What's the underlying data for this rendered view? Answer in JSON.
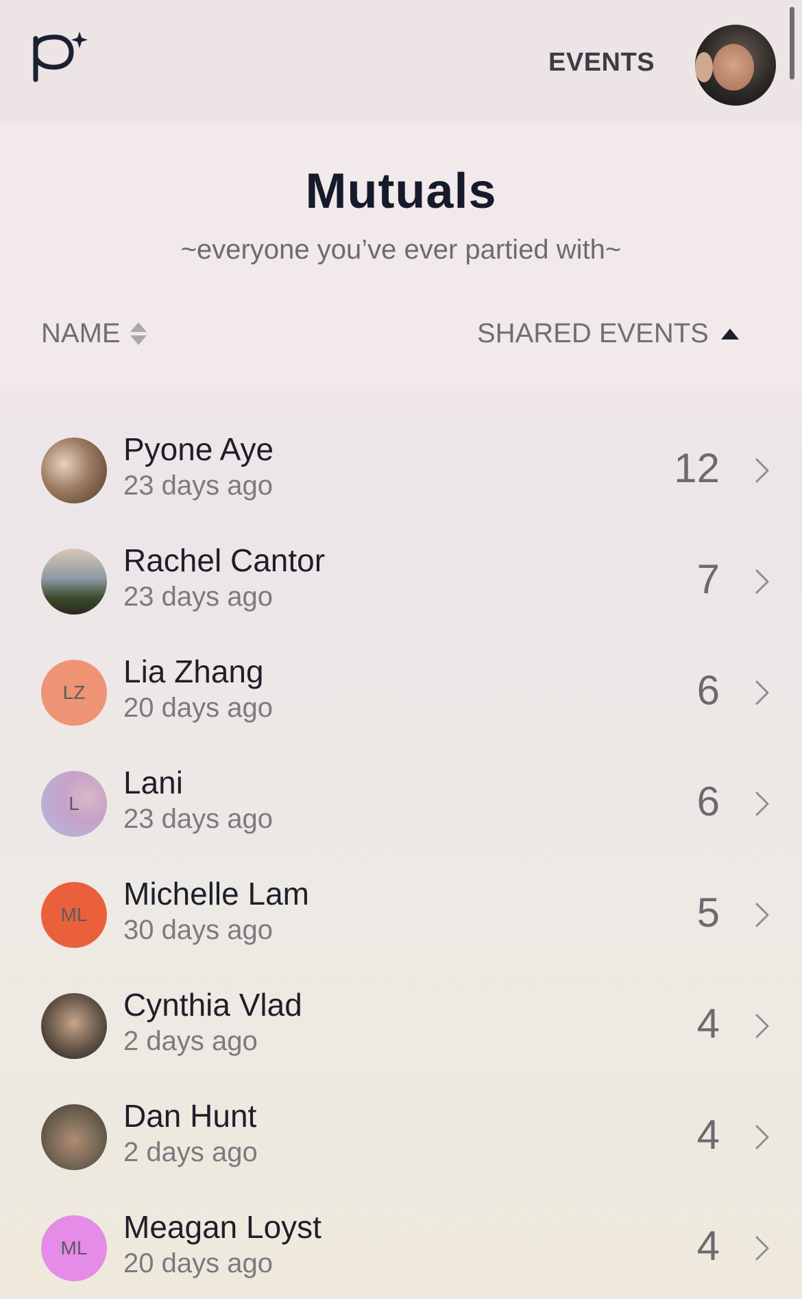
{
  "header": {
    "logo_icon": "p-sparkle-logo",
    "nav_events": "EVENTS",
    "user_avatar": "user-profile-photo"
  },
  "page": {
    "title": "Mutuals",
    "subtitle": "~everyone you’ve ever partied with~"
  },
  "columns": {
    "name": "NAME",
    "shared_events": "SHARED EVENTS",
    "name_sort": "unsorted",
    "shared_sort": "ascending"
  },
  "mutuals": [
    {
      "name": "Pyone Aye",
      "last_seen": "23 days ago",
      "shared_events": "12",
      "avatar": {
        "type": "photo"
      }
    },
    {
      "name": "Rachel Cantor",
      "last_seen": "23 days ago",
      "shared_events": "7",
      "avatar": {
        "type": "photo"
      }
    },
    {
      "name": "Lia Zhang",
      "last_seen": "20 days ago",
      "shared_events": "6",
      "avatar": {
        "type": "initials",
        "initials": "LZ",
        "color": "#EE9374"
      }
    },
    {
      "name": "Lani",
      "last_seen": "23 days ago",
      "shared_events": "6",
      "avatar": {
        "type": "initials",
        "initials": "L",
        "color": "#C9A7C6"
      }
    },
    {
      "name": "Michelle Lam",
      "last_seen": "30 days ago",
      "shared_events": "5",
      "avatar": {
        "type": "initials",
        "initials": "ML",
        "color": "#E9603B"
      }
    },
    {
      "name": "Cynthia Vlad",
      "last_seen": "2 days ago",
      "shared_events": "4",
      "avatar": {
        "type": "photo"
      }
    },
    {
      "name": "Dan Hunt",
      "last_seen": "2 days ago",
      "shared_events": "4",
      "avatar": {
        "type": "photo"
      }
    },
    {
      "name": "Meagan Loyst",
      "last_seen": "20 days ago",
      "shared_events": "4",
      "avatar": {
        "type": "initials",
        "initials": "ML",
        "color": "#E58BE8"
      }
    }
  ]
}
